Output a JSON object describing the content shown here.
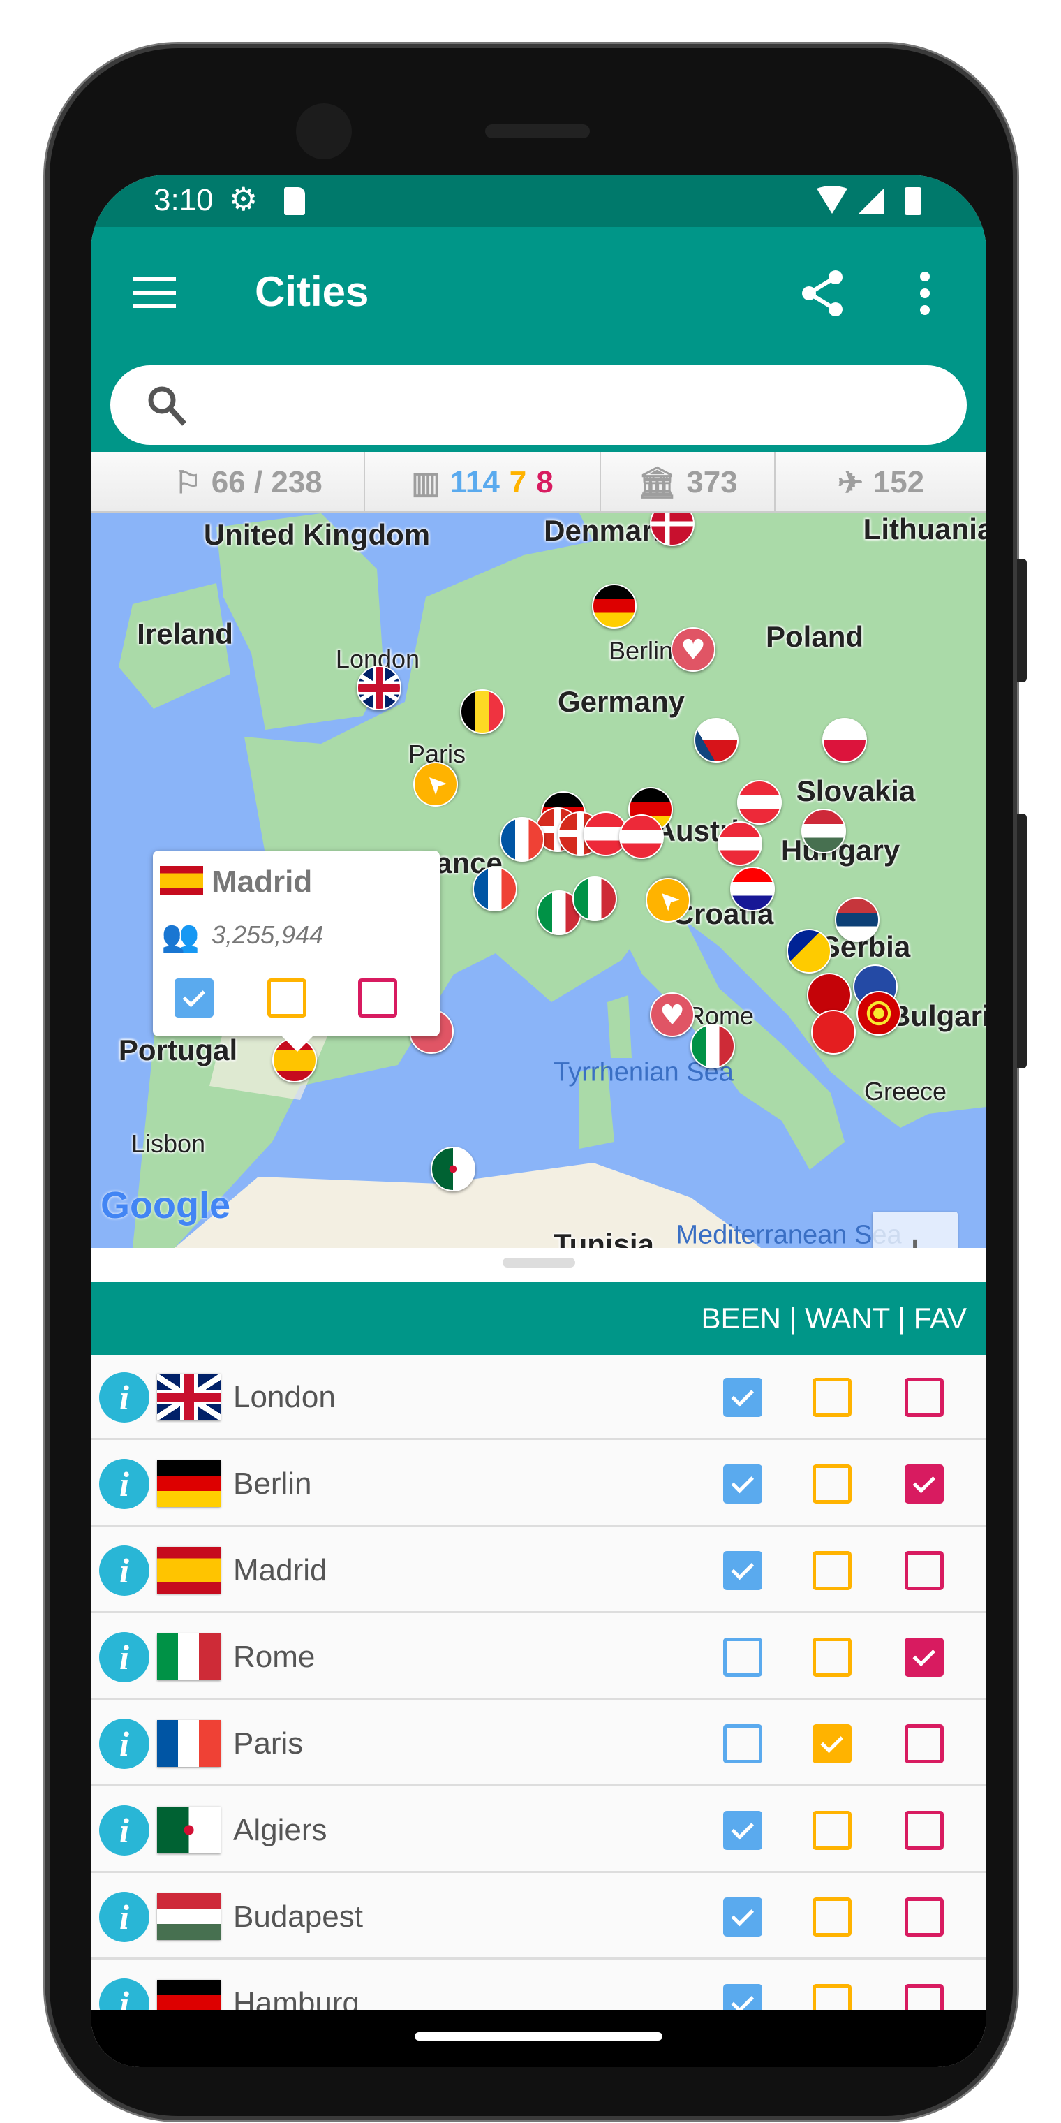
{
  "status_bar": {
    "time": "3:10"
  },
  "app_bar": {
    "title": "Cities",
    "menu_icon": "hamburger-icon",
    "share_icon": "share-icon",
    "overflow_icon": "more-vert-icon"
  },
  "search": {
    "placeholder": "",
    "value": ""
  },
  "stats": {
    "countries": "66 / 238",
    "cities_been": "114",
    "cities_want": "7",
    "cities_fav": "8",
    "unesco": "373",
    "airports": "152"
  },
  "map": {
    "labels": [
      "United Kingdom",
      "Ireland",
      "London",
      "Denmark",
      "Lithuania",
      "Berlin",
      "Poland",
      "Germany",
      "Paris",
      "Slovakia",
      "Austria",
      "Hungary",
      "France",
      "Croatia",
      "Serbia",
      "Bulgaria",
      "Portugal",
      "Rome",
      "Greece",
      "Lisbon",
      "Tunisia"
    ],
    "seas": [
      "Tyrrhenian Sea",
      "Mediterranean Sea"
    ],
    "attribution": "Google",
    "zoom_in": "+",
    "zoom_out": "−",
    "popup": {
      "city": "Madrid",
      "population": "3,255,944",
      "been": true,
      "want": false,
      "fav": false
    }
  },
  "list": {
    "header": "BEEN | WANT | FAV",
    "rows": [
      {
        "city": "London",
        "flag": "gb",
        "been": true,
        "want": false,
        "fav": false
      },
      {
        "city": "Berlin",
        "flag": "de",
        "been": true,
        "want": false,
        "fav": true
      },
      {
        "city": "Madrid",
        "flag": "es",
        "been": true,
        "want": false,
        "fav": false
      },
      {
        "city": "Rome",
        "flag": "it",
        "been": false,
        "want": false,
        "fav": true
      },
      {
        "city": "Paris",
        "flag": "fr",
        "been": false,
        "want": true,
        "fav": false
      },
      {
        "city": "Algiers",
        "flag": "dz",
        "been": true,
        "want": false,
        "fav": false
      },
      {
        "city": "Budapest",
        "flag": "hu",
        "been": true,
        "want": false,
        "fav": false
      },
      {
        "city": "Hamburg",
        "flag": "de",
        "been": true,
        "want": false,
        "fav": false
      }
    ]
  },
  "colors": {
    "primary": "#009688",
    "primary_dark": "#00796b",
    "been": "#5aaaee",
    "want": "#ffb300",
    "fav": "#d81b60",
    "info": "#29b6d6"
  }
}
